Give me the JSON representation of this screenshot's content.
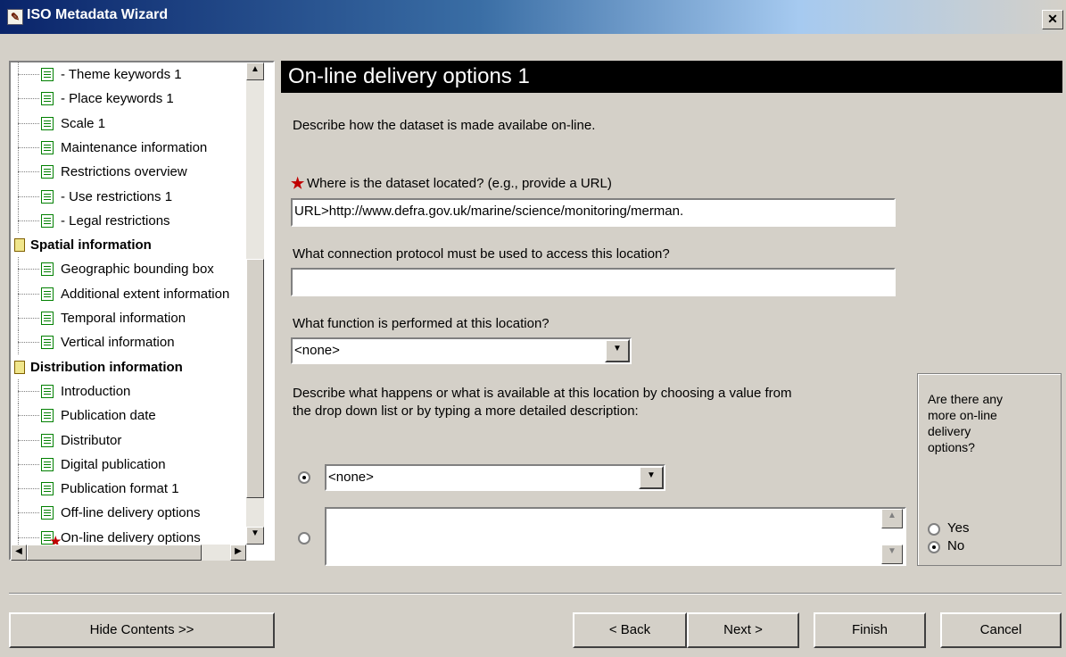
{
  "window": {
    "title": "ISO Metadata Wizard",
    "close_label": "✕"
  },
  "tree": {
    "items": [
      {
        "label": "- Theme keywords 1",
        "type": "page"
      },
      {
        "label": "- Place keywords 1",
        "type": "page"
      },
      {
        "label": "Scale 1",
        "type": "page"
      },
      {
        "label": "Maintenance information",
        "type": "page"
      },
      {
        "label": "Restrictions overview",
        "type": "page"
      },
      {
        "label": "- Use restrictions 1",
        "type": "page"
      },
      {
        "label": "- Legal restrictions",
        "type": "page"
      },
      {
        "label": "Spatial information",
        "type": "group"
      },
      {
        "label": "Geographic bounding box",
        "type": "page"
      },
      {
        "label": "Additional extent information",
        "type": "page"
      },
      {
        "label": "Temporal information",
        "type": "page"
      },
      {
        "label": "Vertical information",
        "type": "page"
      },
      {
        "label": "Distribution information",
        "type": "group"
      },
      {
        "label": "Introduction",
        "type": "page"
      },
      {
        "label": "Publication date",
        "type": "page"
      },
      {
        "label": "Distributor",
        "type": "page"
      },
      {
        "label": "Digital publication",
        "type": "page"
      },
      {
        "label": "Publication format 1",
        "type": "page"
      },
      {
        "label": "Off-line delivery options",
        "type": "page"
      },
      {
        "label": "On-line delivery options",
        "type": "page-required"
      }
    ],
    "scroll_up": "▲",
    "scroll_down": "▼",
    "scroll_left": "◀",
    "scroll_right": "▶"
  },
  "main": {
    "heading": "On-line delivery options 1",
    "description": "Describe how the dataset is made availabe on-line.",
    "required_star": "★",
    "q_location": "Where is the dataset located? (e.g., provide a URL)",
    "location_value": "URL>http://www.defra.gov.uk/marine/science/monitoring/merman.",
    "q_protocol": "What connection protocol must be used to access this location?",
    "protocol_value": "",
    "q_function": "What function is performed at this location?",
    "function_value": "<none>",
    "q_describe_line1": "Describe what happens or what is available at this location by choosing a value from",
    "q_describe_line2": "the drop down list or by typing a more detailed description:",
    "describe_choice_value": "<none>",
    "describe_text_value": "",
    "more_question_lines": [
      "Are there any",
      "more on-line",
      "delivery",
      "options?"
    ],
    "yes_label": "Yes",
    "no_label": "No",
    "dropdown_arrow": "▼"
  },
  "buttons": {
    "hide_contents": "Hide Contents >>",
    "back": "< Back",
    "next": "Next >",
    "finish": "Finish",
    "cancel": "Cancel"
  }
}
